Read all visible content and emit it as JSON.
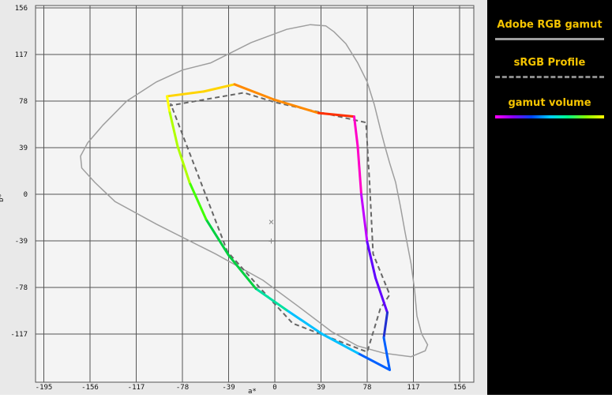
{
  "chart_data": {
    "type": "line",
    "title": "",
    "xlabel": "a*",
    "ylabel": "b*",
    "xlim": [
      -195,
      156
    ],
    "ylim": [
      -156,
      156
    ],
    "x_ticks": [
      -195,
      -156,
      -117,
      -78,
      -39,
      0,
      39,
      78,
      117,
      156
    ],
    "y_ticks": [
      -117,
      -78,
      -39,
      0,
      39,
      78,
      117,
      156
    ],
    "x_tick_labels": [
      "-195",
      "-156",
      "-117",
      "-78",
      "-39",
      "0",
      "39",
      "78",
      "117",
      "156"
    ],
    "y_tick_labels": [
      "-117",
      "-78",
      "-39",
      "0",
      "39",
      "78",
      "117",
      "156"
    ],
    "grid": true,
    "legend_position": "right",
    "series": [
      {
        "name": "Adobe RGB gamut",
        "style": "solid",
        "color": "#9e9e9e",
        "points": [
          [
            -54,
            110
          ],
          [
            -20,
            127
          ],
          [
            10,
            138
          ],
          [
            30,
            142
          ],
          [
            43,
            141
          ],
          [
            50,
            136
          ],
          [
            60,
            126
          ],
          [
            70,
            110
          ],
          [
            78,
            94
          ],
          [
            84,
            75
          ],
          [
            89,
            55
          ],
          [
            93,
            40
          ],
          [
            97,
            26
          ],
          [
            102,
            10
          ],
          [
            106,
            -10
          ],
          [
            110,
            -32
          ],
          [
            115,
            -58
          ],
          [
            118,
            -80
          ],
          [
            120,
            -102
          ],
          [
            124,
            -117
          ],
          [
            129,
            -126
          ],
          [
            127,
            -131
          ],
          [
            115,
            -136
          ],
          [
            92,
            -133
          ],
          [
            70,
            -127
          ],
          [
            48,
            -115
          ],
          [
            20,
            -94
          ],
          [
            -10,
            -72
          ],
          [
            -50,
            -50
          ],
          [
            -100,
            -25
          ],
          [
            -135,
            -6
          ],
          [
            -152,
            10
          ],
          [
            -163,
            22
          ],
          [
            -164,
            32
          ],
          [
            -158,
            43
          ],
          [
            -145,
            58
          ],
          [
            -125,
            78
          ],
          [
            -100,
            94
          ],
          [
            -78,
            104
          ],
          [
            -54,
            110
          ]
        ]
      },
      {
        "name": "sRGB Profile",
        "style": "dashed",
        "color": "#666666",
        "points": [
          [
            -90,
            74
          ],
          [
            -26,
            85
          ],
          [
            0,
            77
          ],
          [
            77,
            60
          ],
          [
            80,
            10
          ],
          [
            83,
            -50
          ],
          [
            97,
            -84
          ],
          [
            89,
            -96
          ],
          [
            78,
            -132
          ],
          [
            15,
            -108
          ],
          [
            -12,
            -79
          ],
          [
            -40,
            -48
          ],
          [
            -88,
            76
          ]
        ]
      },
      {
        "name": "gamut volume",
        "style": "gradient",
        "color": "#ff00ff",
        "points": [
          [
            -91,
            82
          ],
          [
            -60,
            86
          ],
          [
            -34,
            92
          ],
          [
            0,
            79
          ],
          [
            37,
            68
          ],
          [
            67,
            65
          ],
          [
            70,
            40
          ],
          [
            73,
            0
          ],
          [
            78,
            -40
          ],
          [
            85,
            -70
          ],
          [
            95,
            -99
          ],
          [
            92,
            -120
          ],
          [
            97,
            -147
          ],
          [
            70,
            -133
          ],
          [
            40,
            -117
          ],
          [
            10,
            -97
          ],
          [
            -16,
            -79
          ],
          [
            -39,
            -51
          ],
          [
            -58,
            -21
          ],
          [
            -72,
            10
          ],
          [
            -82,
            40
          ],
          [
            -89,
            70
          ],
          [
            -91,
            82
          ]
        ]
      }
    ],
    "annotations": [
      {
        "marker": "×",
        "x": -3,
        "y": -23
      },
      {
        "marker": "+",
        "x": -3,
        "y": -39
      }
    ]
  },
  "legend": {
    "adobe_label": "Adobe RGB gamut",
    "srgb_label": "sRGB Profile",
    "volume_label": "gamut volume"
  }
}
